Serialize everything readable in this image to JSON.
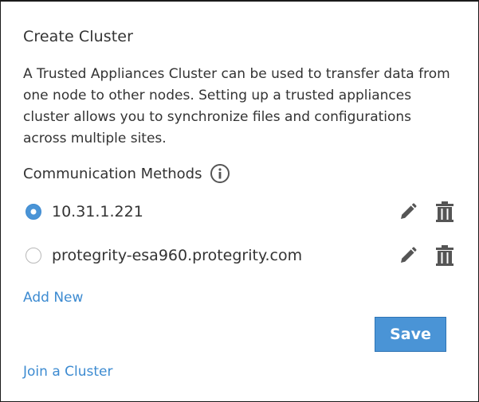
{
  "panel": {
    "title": "Create Cluster",
    "description": "A Trusted Appliances Cluster can be used to transfer data from one node to other nodes. Setting up a trusted appliances cluster allows you to synchronize files and configurations across multiple sites.",
    "communication_methods_label": "Communication Methods",
    "info_icon": "info-circle-icon"
  },
  "methods": [
    {
      "label": "10.31.1.221",
      "selected": true,
      "edit_icon": "pencil-icon",
      "delete_icon": "trash-icon"
    },
    {
      "label": "protegrity-esa960.protegrity.com",
      "selected": false,
      "edit_icon": "pencil-icon",
      "delete_icon": "trash-icon"
    }
  ],
  "actions": {
    "add_new_label": "Add New",
    "save_label": "Save",
    "join_cluster_label": "Join a Cluster"
  },
  "colors": {
    "accent": "#4a94d6",
    "link": "#3d8bd1",
    "text": "#333333",
    "icon": "#555555"
  }
}
